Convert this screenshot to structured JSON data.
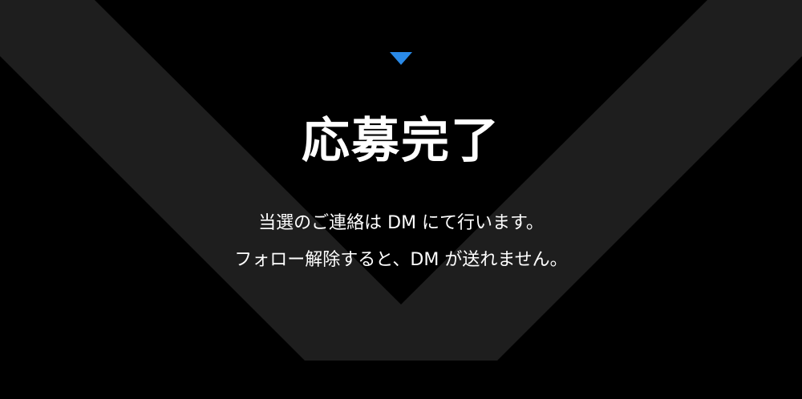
{
  "colors": {
    "background": "#000000",
    "chevron": "#1e1e1e",
    "marker": "#2a8ae8",
    "text": "#ffffff"
  },
  "icons": {
    "marker": "triangle-down-icon"
  },
  "title": "応募完了",
  "message": {
    "line1": "当選のご連絡は DM にて行います。",
    "line2": "フォロー解除すると、DM が送れません。"
  }
}
